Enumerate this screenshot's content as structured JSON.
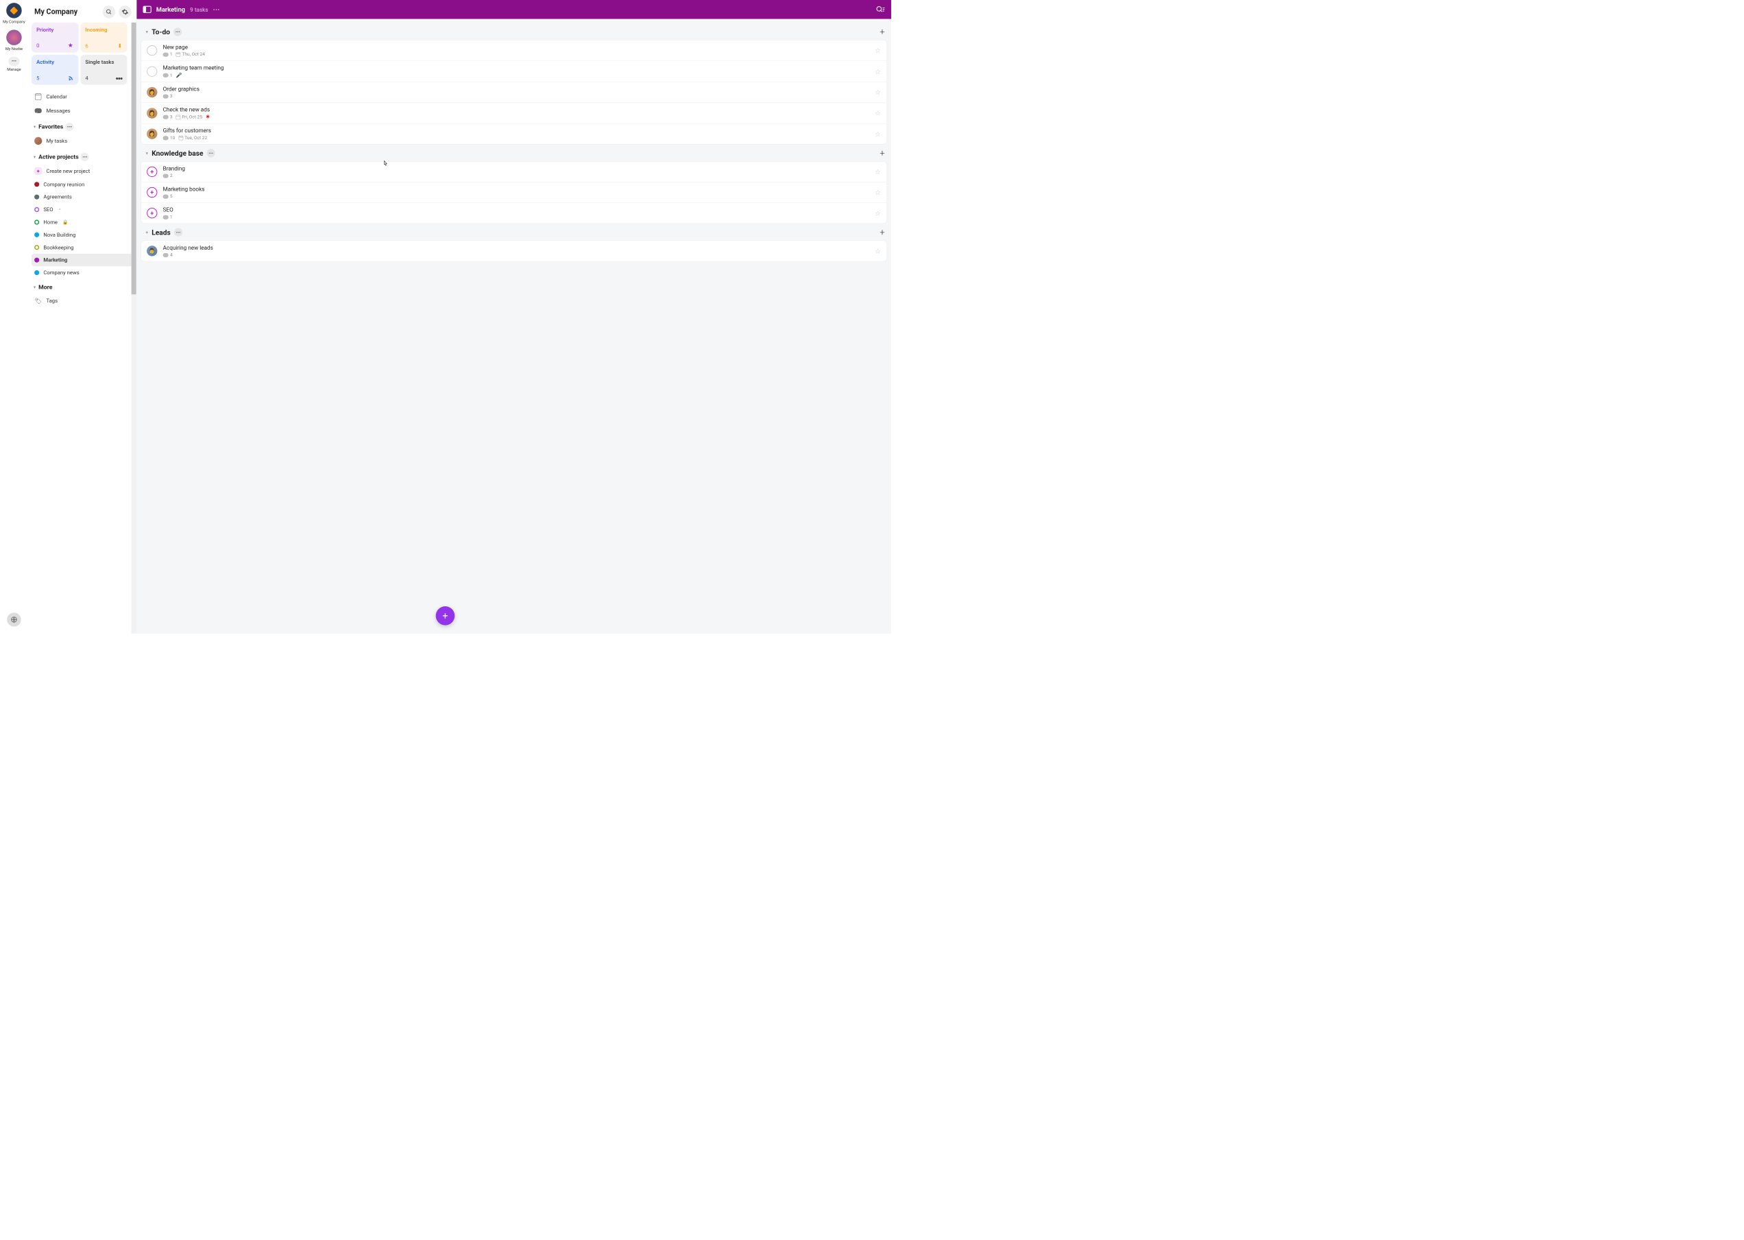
{
  "rail": {
    "items": [
      {
        "label": "My Company",
        "avatar_bg": "#2a3f5f",
        "emoji": "🔶"
      },
      {
        "label": "My Nozbe",
        "avatar_bg": "#c65d7b",
        "emoji": "🟣"
      }
    ],
    "manage_label": "Manage"
  },
  "sidebar": {
    "title": "My Company",
    "cards": {
      "priority": {
        "title": "Priority",
        "count": "0"
      },
      "incoming": {
        "title": "Incoming",
        "count": "6"
      },
      "activity": {
        "title": "Activity",
        "count": "5"
      },
      "single": {
        "title": "Single tasks",
        "count": "4"
      }
    },
    "links": {
      "calendar": "Calendar",
      "messages": "Messages"
    },
    "favorites": {
      "title": "Favorites",
      "items": [
        {
          "label": "My tasks"
        }
      ]
    },
    "projects": {
      "title": "Active projects",
      "create": "Create new project",
      "items": [
        {
          "label": "Company reunion",
          "color": "#a61b2b"
        },
        {
          "label": "Agreements",
          "color": "#5b7065"
        },
        {
          "label": "SEO",
          "color": "#a855f7",
          "ring": true,
          "badge": "share"
        },
        {
          "label": "Home",
          "color": "#16a34a",
          "ring": true,
          "badge": "lock"
        },
        {
          "label": "Nova Building",
          "color": "#0ea5e9"
        },
        {
          "label": "Bookkeeping",
          "color": "#a3a80f",
          "ring": true
        },
        {
          "label": "Marketing",
          "color": "#a21caf",
          "active": true
        },
        {
          "label": "Company news",
          "color": "#0ea5e9"
        }
      ]
    },
    "more": {
      "title": "More",
      "tags": "Tags"
    }
  },
  "header": {
    "title": "Marketing",
    "subtitle": "9 tasks"
  },
  "sections": [
    {
      "title": "To-do",
      "tasks": [
        {
          "title": "New page",
          "check": "circle",
          "comments": "1",
          "date": "Thu, Oct 24"
        },
        {
          "title": "Marketing team meeting",
          "check": "circle",
          "comments": "1",
          "mic": true
        },
        {
          "title": "Order graphics",
          "check": "avatar",
          "comments": "3"
        },
        {
          "title": "Check the new ads",
          "check": "avatar",
          "comments": "3",
          "date": "Fri, Oct 25",
          "flag": true
        },
        {
          "title": "Gifts for customers",
          "check": "avatar",
          "comments": "10",
          "date": "Tue, Oct 22"
        }
      ]
    },
    {
      "title": "Knowledge base",
      "tasks": [
        {
          "title": "Branding",
          "check": "plus",
          "comments": "2"
        },
        {
          "title": "Marketing books",
          "check": "plus",
          "comments": "5"
        },
        {
          "title": "SEO",
          "check": "plus",
          "comments": "1"
        }
      ]
    },
    {
      "title": "Leads",
      "tasks": [
        {
          "title": "Acquiring new leads",
          "check": "avatar2",
          "comments": "4"
        }
      ]
    }
  ]
}
